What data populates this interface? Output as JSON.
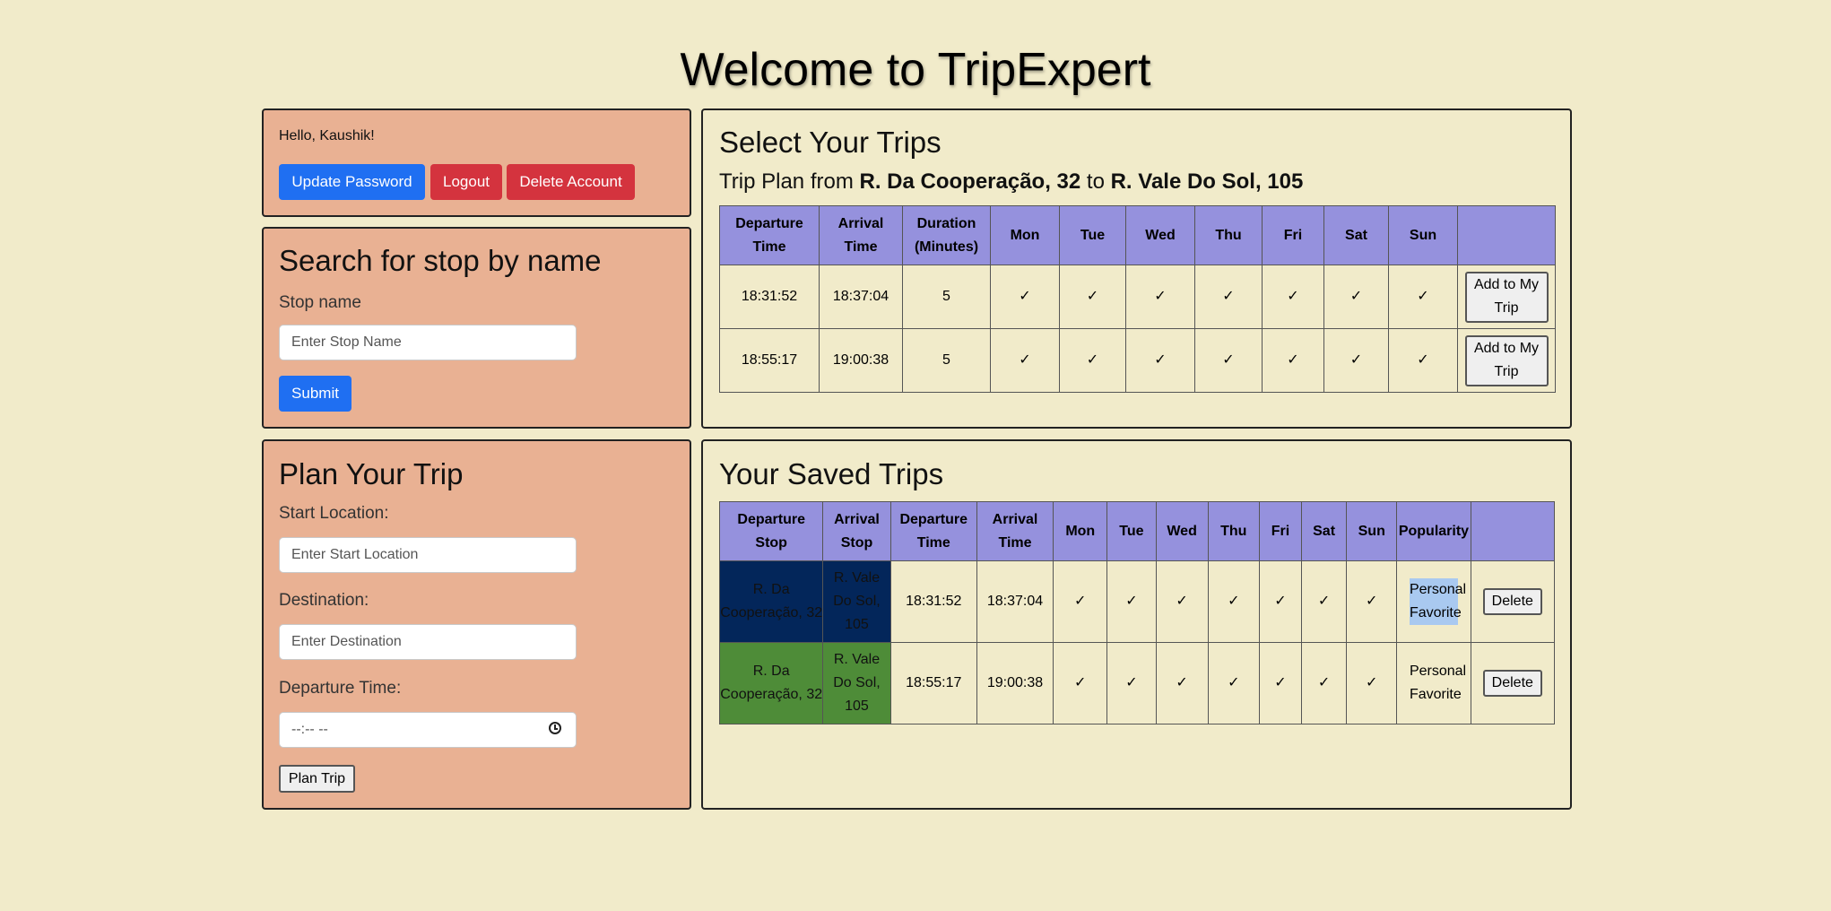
{
  "page": {
    "title": "Welcome to TripExpert"
  },
  "account": {
    "greeting": "Hello, Kaushik!",
    "update_password_label": "Update Password",
    "logout_label": "Logout",
    "delete_account_label": "Delete Account"
  },
  "search_stop": {
    "heading": "Search for stop by name",
    "field_label": "Stop name",
    "placeholder": "Enter Stop Name",
    "submit_label": "Submit"
  },
  "plan_trip": {
    "heading": "Plan Your Trip",
    "start_label": "Start Location:",
    "start_placeholder": "Enter Start Location",
    "destination_label": "Destination:",
    "destination_placeholder": "Enter Destination",
    "time_label": "Departure Time:",
    "time_value": "--:-- --",
    "submit_label": "Plan Trip"
  },
  "select_trips": {
    "heading": "Select Your Trips",
    "plan_prefix": "Trip Plan from",
    "from": "R. Da Cooperação, 32",
    "to_word": "to",
    "to": "R. Vale Do Sol, 105",
    "columns": [
      "Departure Time",
      "Arrival Time",
      "Duration (Minutes)",
      "Mon",
      "Tue",
      "Wed",
      "Thu",
      "Fri",
      "Sat",
      "Sun",
      ""
    ],
    "rows": [
      {
        "departure": "18:31:52",
        "arrival": "18:37:04",
        "duration": "5",
        "days": [
          "✓",
          "✓",
          "✓",
          "✓",
          "✓",
          "✓",
          "✓"
        ],
        "action": "Add to My Trip"
      },
      {
        "departure": "18:55:17",
        "arrival": "19:00:38",
        "duration": "5",
        "days": [
          "✓",
          "✓",
          "✓",
          "✓",
          "✓",
          "✓",
          "✓"
        ],
        "action": "Add to My Trip"
      }
    ]
  },
  "saved_trips": {
    "heading": "Your Saved Trips",
    "columns": [
      "Departure Stop",
      "Arrival Stop",
      "Departure Time",
      "Arrival Time",
      "Mon",
      "Tue",
      "Wed",
      "Thu",
      "Fri",
      "Sat",
      "Sun",
      "Popularity",
      ""
    ],
    "rows": [
      {
        "departure_stop": "R. Da Cooperação, 32",
        "arrival_stop": "R. Vale Do Sol, 105",
        "departure_time": "18:31:52",
        "arrival_time": "18:37:04",
        "days": [
          "✓",
          "✓",
          "✓",
          "✓",
          "✓",
          "✓",
          "✓"
        ],
        "popularity": "Personal Favorite",
        "action": "Delete",
        "stop_color": "#03265a"
      },
      {
        "departure_stop": "R. Da Cooperação, 32",
        "arrival_stop": "R. Vale Do Sol, 105",
        "departure_time": "18:55:17",
        "arrival_time": "19:00:38",
        "days": [
          "✓",
          "✓",
          "✓",
          "✓",
          "✓",
          "✓",
          "✓"
        ],
        "popularity": "Personal Favorite",
        "action": "Delete",
        "stop_color": "#4e8c38"
      }
    ]
  },
  "colors": {
    "background": "#f1ebca",
    "panel_salmon": "#e9b193",
    "table_header": "#9591dd",
    "primary_button": "#1f6ff2",
    "danger_button": "#d4333e"
  }
}
